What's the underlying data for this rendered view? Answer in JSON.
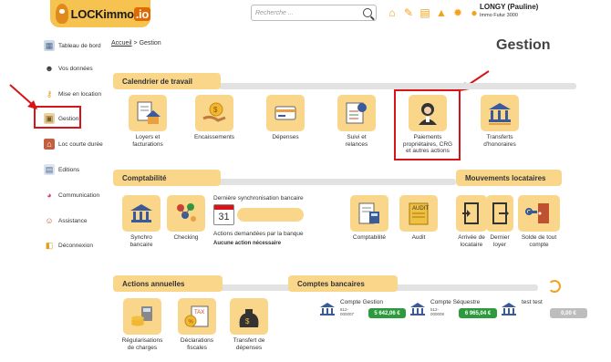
{
  "app": {
    "logo_text": "LOCKimmo",
    "logo_suffix": ".io"
  },
  "search": {
    "placeholder": "Recherche ..."
  },
  "header_icons": [
    "home-icon",
    "edit-icon",
    "document-icon",
    "bell-icon",
    "gear-icon",
    "user-icon"
  ],
  "user": {
    "name": "LONGY (Pauline)",
    "company": "Immo Futur 3000"
  },
  "sidebar": {
    "items": [
      {
        "label": "Tableau de bord",
        "icon": "dashboard-icon"
      },
      {
        "label": "Vos données",
        "icon": "person-icon"
      },
      {
        "label": "Mise en location",
        "icon": "key-icon"
      },
      {
        "label": "Gestion",
        "icon": "management-icon"
      },
      {
        "label": "Loc courte durée",
        "icon": "short-rental-icon"
      },
      {
        "label": "Editions",
        "icon": "print-icon"
      },
      {
        "label": "Communication",
        "icon": "chat-icon"
      },
      {
        "label": "Assistance",
        "icon": "support-icon"
      },
      {
        "label": "Déconnexion",
        "icon": "logout-icon"
      }
    ]
  },
  "breadcrumb": {
    "home": "Accueil",
    "separator": ">",
    "current": "Gestion"
  },
  "page_title": "Gestion",
  "calendrier": {
    "title": "Calendrier de travail",
    "tiles": [
      {
        "label": "Loyers et\nfacturations",
        "icon": "rent-invoice-icon"
      },
      {
        "label": "Encaissements",
        "icon": "cash-in-icon"
      },
      {
        "label": "Dépenses",
        "icon": "expenses-icon"
      },
      {
        "label": "Suivi et\nrelances",
        "icon": "follow-up-icon"
      },
      {
        "label": "Paiements\npropriétaires, CRG\net autres actions",
        "icon": "owner-payment-icon"
      },
      {
        "label": "Transferts\nd'honoraires",
        "icon": "fee-transfer-icon"
      }
    ]
  },
  "comptabilite": {
    "title": "Comptabilité",
    "tiles": [
      {
        "label": "Synchro\nbancaire",
        "icon": "bank-sync-icon"
      },
      {
        "label": "Checking",
        "icon": "checking-icon"
      },
      {
        "label": "Comptabilité",
        "icon": "accounting-icon"
      },
      {
        "label": "Audit",
        "icon": "audit-icon"
      }
    ],
    "last_sync_label": "Dernière synchronisation bancaire",
    "calendar_day": "31",
    "actions_requested": "Actions demandées par la banque",
    "no_action": "Aucune action nécessaire"
  },
  "mouvements": {
    "title": "Mouvements locataires",
    "tiles": [
      {
        "label": "Arrivée de\nlocataire",
        "icon": "tenant-arrival-icon"
      },
      {
        "label": "Dernier\nloyer",
        "icon": "last-rent-icon"
      },
      {
        "label": "Solde de tout\ncompte",
        "icon": "final-settlement-icon"
      }
    ]
  },
  "annuelles": {
    "title": "Actions annuelles",
    "tiles": [
      {
        "label": "Régularisations\nde charges",
        "icon": "charges-regularisation-icon"
      },
      {
        "label": "Déclarations\nfiscales",
        "icon": "tax-declaration-icon"
      },
      {
        "label": "Transfert de\ndépenses",
        "icon": "expense-transfer-icon"
      }
    ]
  },
  "comptes": {
    "title": "Comptes bancaires",
    "accounts": [
      {
        "name": "Compte Gestion",
        "number_line1": "512-",
        "number_line2": "000007",
        "amount": "5 642,06 €",
        "color": "#2e9a3e"
      },
      {
        "name": "Compte Séquestre",
        "number_line1": "512-",
        "number_line2": "000008",
        "amount": "6 965,04 €",
        "color": "#2e9a3e"
      },
      {
        "name": "test test",
        "number_line1": "",
        "number_line2": "",
        "amount": "0,00 €",
        "color": "#bdbdbd"
      }
    ]
  },
  "colors": {
    "accent": "#f9d68a",
    "highlight": "#d8141a",
    "header_icon": "#f2a21b"
  }
}
